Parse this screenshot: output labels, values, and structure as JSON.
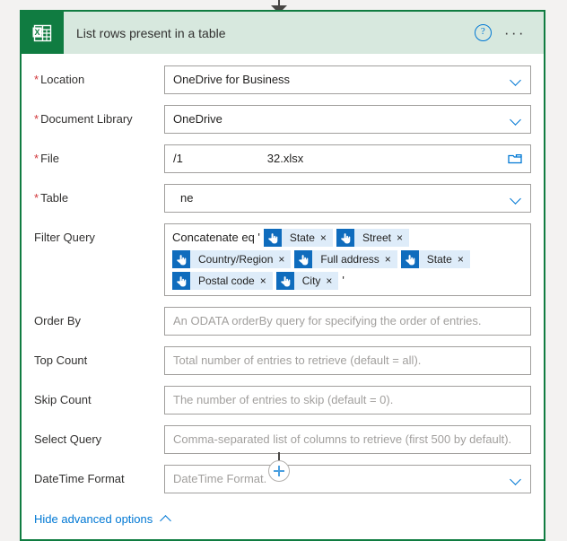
{
  "connector": {
    "top_arrow_icon": "arrow-down-icon",
    "bottom_plus_icon": "plus-icon"
  },
  "card": {
    "app_icon": "excel-icon",
    "title": "List rows present in a table",
    "help_icon": "?",
    "ellipsis_icon": "···",
    "accent_color": "#107c41",
    "header_color": "#d7e8de",
    "link_color": "#0078d4"
  },
  "fields": {
    "location": {
      "label": "Location",
      "required": true,
      "required_marker": "*",
      "value": "OneDrive for Business",
      "control": "dropdown",
      "icon": "chevron-down-icon"
    },
    "document_library": {
      "label": "Document Library",
      "required": true,
      "required_marker": "*",
      "value": "OneDrive",
      "control": "dropdown",
      "icon": "chevron-down-icon"
    },
    "file": {
      "label": "File",
      "required": true,
      "required_marker": "*",
      "value": "/1                          32.xlsx",
      "control": "file-picker",
      "icon": "folder-icon"
    },
    "table": {
      "label": "Table",
      "required": true,
      "required_marker": "*",
      "value": "ne",
      "control": "dropdown",
      "icon": "chevron-down-icon"
    },
    "filter_query": {
      "label": "Filter Query",
      "required": false,
      "control": "token-field",
      "prefix_text": "Concatenate eq '",
      "suffix_text": "'",
      "token_icon": "hand-pointer-icon",
      "token_remove_icon": "×",
      "tokens": [
        {
          "label": "State"
        },
        {
          "label": "Street"
        },
        {
          "label": "Country/Region"
        },
        {
          "label": "Full address"
        },
        {
          "label": "State"
        },
        {
          "label": "Postal code"
        },
        {
          "label": "City"
        }
      ]
    },
    "order_by": {
      "label": "Order By",
      "required": false,
      "value": "",
      "placeholder": "An ODATA orderBy query for specifying the order of entries.",
      "control": "text"
    },
    "top_count": {
      "label": "Top Count",
      "required": false,
      "value": "",
      "placeholder": "Total number of entries to retrieve (default = all).",
      "control": "text"
    },
    "skip_count": {
      "label": "Skip Count",
      "required": false,
      "value": "",
      "placeholder": "The number of entries to skip (default = 0).",
      "control": "text"
    },
    "select_query": {
      "label": "Select Query",
      "required": false,
      "value": "",
      "placeholder": "Comma-separated list of columns to retrieve (first 500 by default).",
      "control": "text"
    },
    "datetime_format": {
      "label": "DateTime Format",
      "required": false,
      "value": "",
      "placeholder": "DateTime Format.",
      "control": "dropdown",
      "icon": "chevron-down-icon"
    }
  },
  "footer": {
    "advanced_label": "Hide advanced options",
    "advanced_icon": "chevron-up-icon"
  }
}
